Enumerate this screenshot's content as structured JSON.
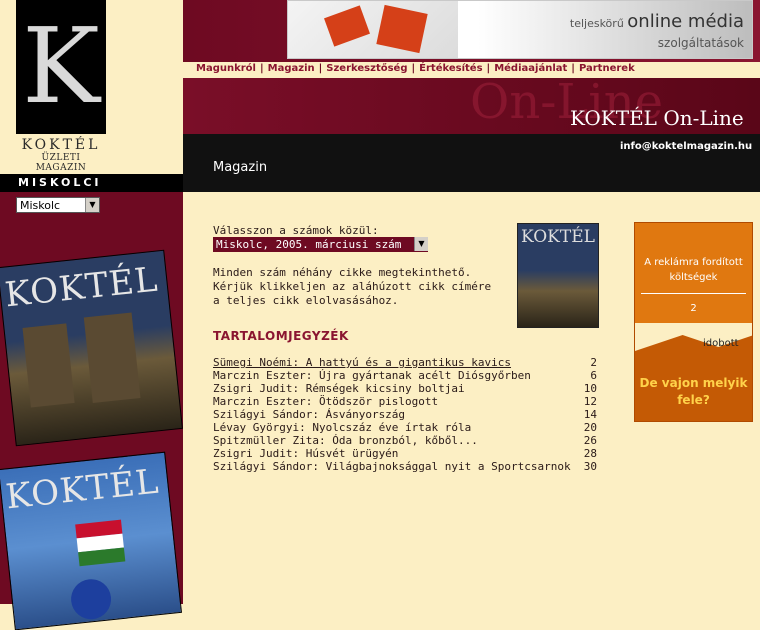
{
  "brand": {
    "logo_letter": "K",
    "logo_name": "KOKTÉL",
    "logo_subtitle": "ÜZLETI MAGAZIN",
    "city_label": "MISKOLCI",
    "title": "KOKTÉL On-Line",
    "email": "info@koktelmagazin.hu"
  },
  "city_select": {
    "value": "Miskolc"
  },
  "ad_banner": {
    "line1_prefix": "teljeskörű",
    "line1_big": "online média",
    "line2": "szolgáltatások"
  },
  "nav": {
    "items": [
      {
        "label": "Magunkról"
      },
      {
        "label": "Magazin"
      },
      {
        "label": "Szerkesztőség"
      },
      {
        "label": "Értékesítés"
      },
      {
        "label": "Médiaajánlat"
      },
      {
        "label": "Partnerek"
      }
    ],
    "separator": "|"
  },
  "section": {
    "title": "Magazin"
  },
  "issues": {
    "label": "Válasszon a számok közül:",
    "selected": "Miskolc, 2005. márciusi szám",
    "intro_lines": [
      "Minden szám néhány cikke megtekinthető.",
      "Kérjük klikkeljen az aláhúzott cikk címére",
      "a teljes cikk elolvasásához."
    ]
  },
  "covers": {
    "title": "KOKTÉL"
  },
  "toc": {
    "title": "TARTALOMJEGYZÉK",
    "items": [
      {
        "title": "Sümegi Noémi: A hattyú és a gigantikus kavics",
        "page": "2",
        "link": true
      },
      {
        "title": "Marczin Eszter: Újra gyártanak acélt Diósgyőrben",
        "page": "6",
        "link": false
      },
      {
        "title": "Zsigri Judit: Rémségek kicsiny boltjai",
        "page": "10",
        "link": false
      },
      {
        "title": "Marczin Eszter: Ötödször pislogott",
        "page": "12",
        "link": false
      },
      {
        "title": "Szilágyi Sándor: Ásványország",
        "page": "14",
        "link": false
      },
      {
        "title": "Lévay Györgyi: Nyolcszáz éve írtak róla",
        "page": "20",
        "link": false
      },
      {
        "title": "Spitzmüller Zita: Óda bronzból, kőből...",
        "page": "26",
        "link": false
      },
      {
        "title": "Zsigri Judit: Húsvét ürügyén",
        "page": "28",
        "link": false
      },
      {
        "title": "Szilágyi Sándor: Világbajnoksággal nyit a Sportcsarnok",
        "page": "30",
        "link": false
      }
    ]
  },
  "side_ad": {
    "headline": "A reklámra fordított költségek",
    "number": "2",
    "partial": "idobott",
    "question": "De vajon melyik fele?"
  },
  "colors": {
    "maroon": "#6e0a22",
    "cream": "#fcefc4",
    "accent_orange": "#e07810"
  }
}
